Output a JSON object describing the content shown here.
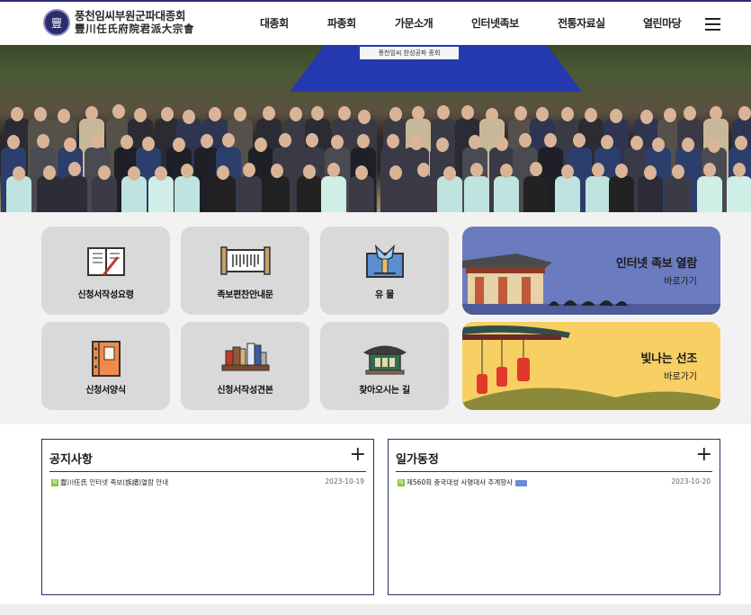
{
  "header": {
    "logo_emblem": "豐",
    "logo_line1": "풍천임씨부원군파대종회",
    "logo_line2": "豐川任氏府院君派大宗會",
    "nav": [
      "대종회",
      "파종회",
      "가문소개",
      "인터넷족보",
      "전통자료실",
      "열린마당"
    ],
    "menu_icon": "hamburger-icon"
  },
  "hero": {
    "banner_text": "풍천임씨 찬성공파 종회",
    "description": "group photo"
  },
  "quick_menu": [
    {
      "label": "신청서작성요령",
      "icon": "book-pen-icon"
    },
    {
      "label": "족보편찬안내문",
      "icon": "scroll-icon"
    },
    {
      "label": "유   물",
      "icon": "artifact-icon"
    },
    {
      "label": "신청서양식",
      "icon": "binder-icon"
    },
    {
      "label": "신청서작성견본",
      "icon": "bookshelf-icon"
    },
    {
      "label": "찾아오시는 길",
      "icon": "building-icon"
    }
  ],
  "banners": [
    {
      "title": "인터넷 족보 열람",
      "sub": "바로가기",
      "color": "#6b7bbf"
    },
    {
      "title": "빛나는 선조",
      "sub": "바로가기",
      "color": "#f7cf63"
    }
  ],
  "notice": {
    "title": "공지사항",
    "plus": "+",
    "items": [
      {
        "badge": "N",
        "text": "豐川任氏 인터넷 족보(族譜)열람 안내",
        "date": "2023-10-19"
      }
    ]
  },
  "news": {
    "title": "일가동정",
    "plus": "+",
    "items": [
      {
        "badge": "N",
        "text": "제560회 충국대성 사명대사 추계향사",
        "date": "2023-10-20"
      }
    ]
  }
}
